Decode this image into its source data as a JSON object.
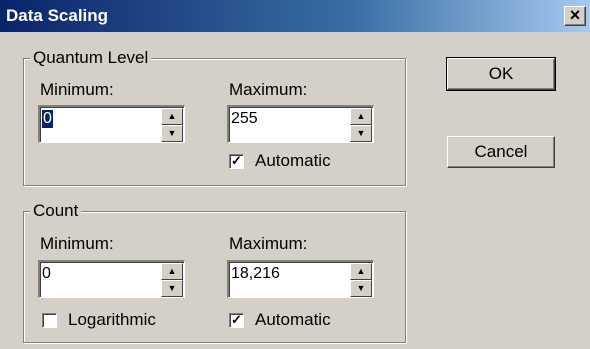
{
  "window": {
    "title": "Data Scaling",
    "close_glyph": "×"
  },
  "quantum": {
    "legend": "Quantum Level",
    "min_label": "Minimum:",
    "min_value": "0",
    "max_label": "Maximum:",
    "max_value": "255",
    "auto_label": "Automatic",
    "auto_checked": true
  },
  "count": {
    "legend": "Count",
    "min_label": "Minimum:",
    "min_value": "0",
    "max_label": "Maximum:",
    "max_value": "18,216",
    "log_label": "Logarithmic",
    "log_checked": false,
    "auto_label": "Automatic",
    "auto_checked": true
  },
  "buttons": {
    "ok": "OK",
    "cancel": "Cancel"
  },
  "glyphs": {
    "up": "▲",
    "down": "▼",
    "check": "✓"
  }
}
